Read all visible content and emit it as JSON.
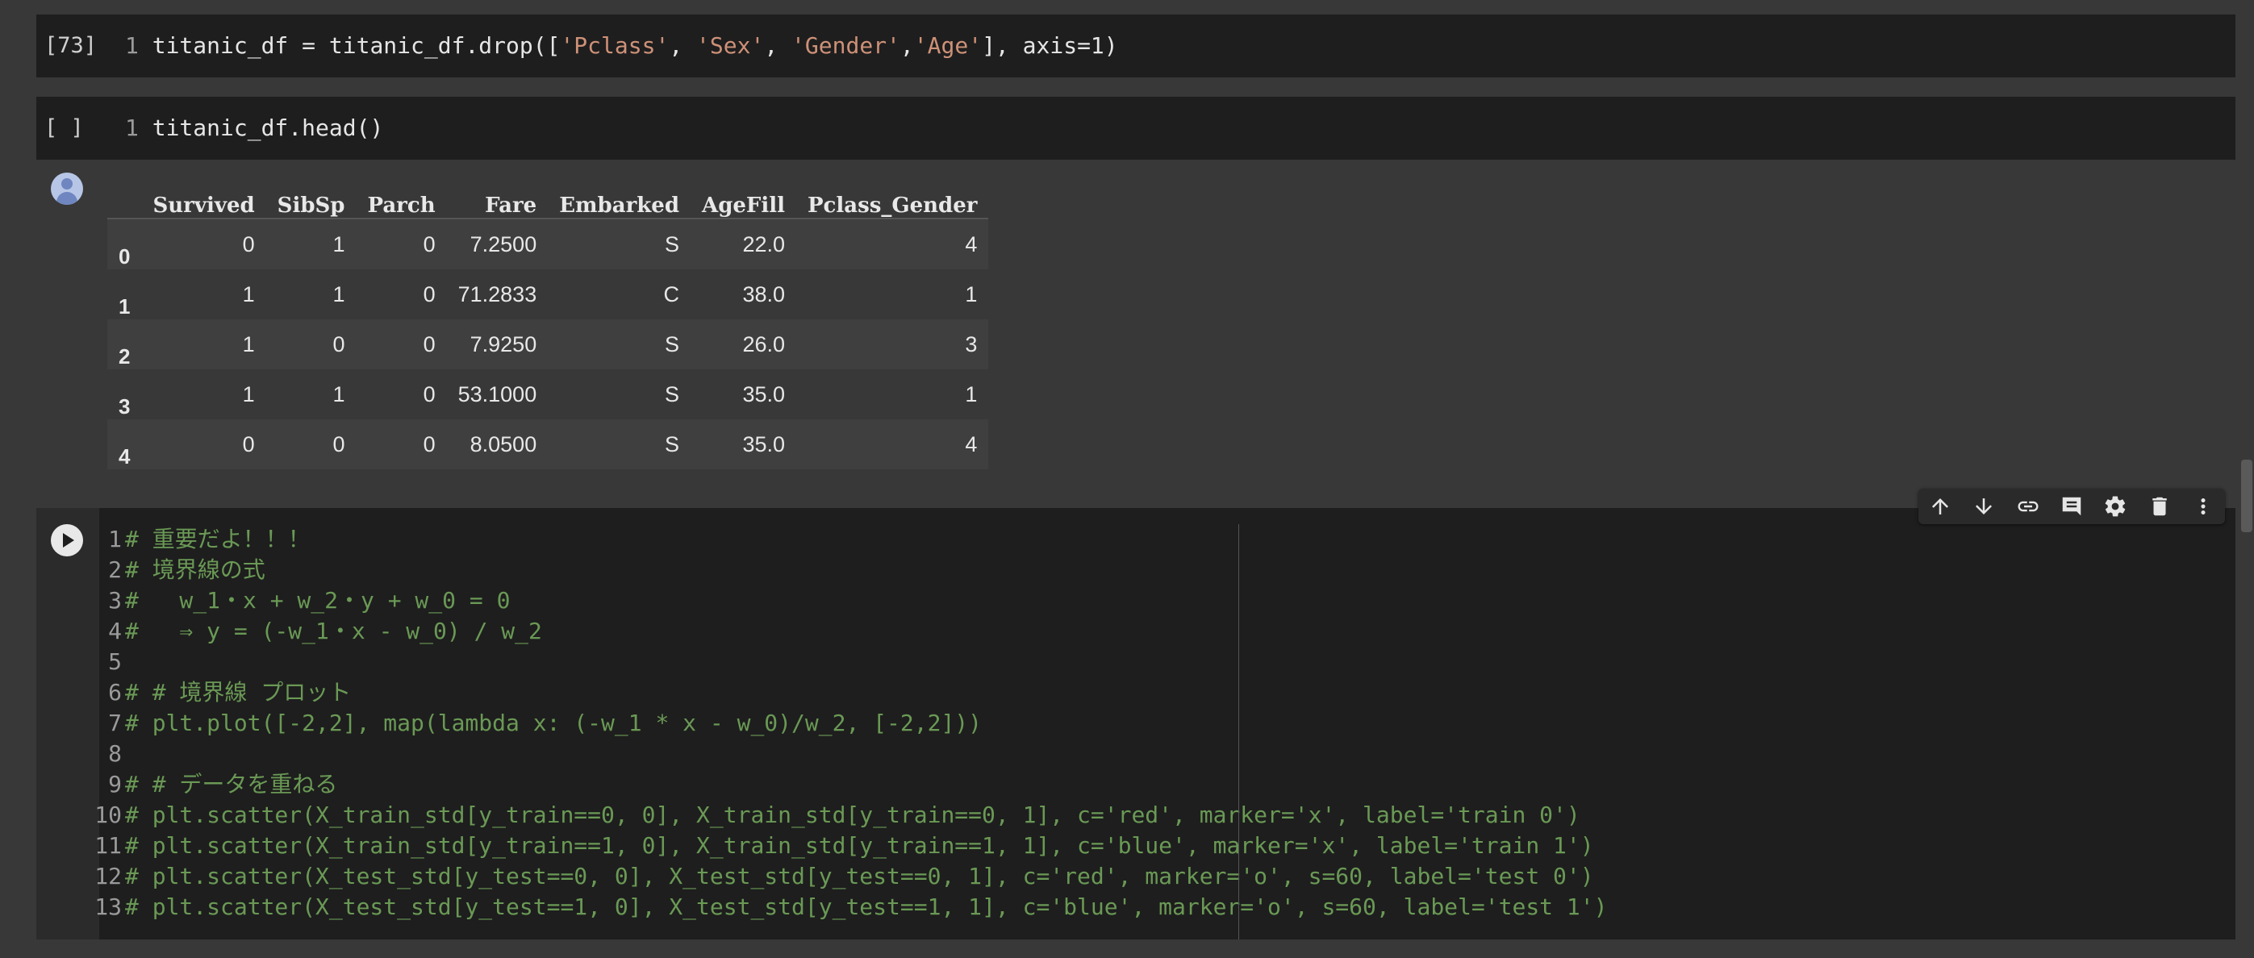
{
  "cells": {
    "drop": {
      "exec_count": "[73]",
      "line_no": "1",
      "code_prefix": "titanic_df = titanic_df.drop([",
      "s1": "'Pclass'",
      "sep1": ", ",
      "s2": "'Sex'",
      "sep2": ", ",
      "s3": "'Gender'",
      "sep3": ",",
      "s4": "'Age'",
      "code_suffix": "], axis=1)"
    },
    "head": {
      "exec_count": "[ ]",
      "line_no": "1",
      "code": "titanic_df.head()"
    },
    "comment_cell": {
      "lines": [
        {
          "n": "1",
          "text": "# 重要だよ！！！"
        },
        {
          "n": "2",
          "text": "# 境界線の式"
        },
        {
          "n": "3",
          "text": "#   w_1・x + w_2・y + w_0 = 0"
        },
        {
          "n": "4",
          "text": "#   ⇒ y = (-w_1・x - w_0) / w_2"
        },
        {
          "n": "5",
          "text": ""
        },
        {
          "n": "6",
          "text": "# # 境界線 プロット"
        },
        {
          "n": "7",
          "text": "# plt.plot([-2,2], map(lambda x: (-w_1 * x - w_0)/w_2, [-2,2]))"
        },
        {
          "n": "8",
          "text": ""
        },
        {
          "n": "9",
          "text": "# # データを重ねる"
        },
        {
          "n": "10",
          "text": "# plt.scatter(X_train_std[y_train==0, 0], X_train_std[y_train==0, 1], c='red', marker='x', label='train 0')"
        },
        {
          "n": "11",
          "text": "# plt.scatter(X_train_std[y_train==1, 0], X_train_std[y_train==1, 1], c='blue', marker='x', label='train 1')"
        },
        {
          "n": "12",
          "text": "# plt.scatter(X_test_std[y_test==0, 0], X_test_std[y_test==0, 1], c='red', marker='o', s=60, label='test 0')"
        },
        {
          "n": "13",
          "text": "# plt.scatter(X_test_std[y_test==1, 0], X_test_std[y_test==1, 1], c='blue', marker='o', s=60, label='test 1')"
        }
      ]
    }
  },
  "dataframe": {
    "columns": [
      "",
      "Survived",
      "SibSp",
      "Parch",
      "Fare",
      "Embarked",
      "AgeFill",
      "Pclass_Gender"
    ],
    "rows": [
      [
        "0",
        "0",
        "1",
        "0",
        "7.2500",
        "S",
        "22.0",
        "4"
      ],
      [
        "1",
        "1",
        "1",
        "0",
        "71.2833",
        "C",
        "38.0",
        "1"
      ],
      [
        "2",
        "1",
        "0",
        "0",
        "7.9250",
        "S",
        "26.0",
        "3"
      ],
      [
        "3",
        "1",
        "1",
        "0",
        "53.1000",
        "S",
        "35.0",
        "1"
      ],
      [
        "4",
        "0",
        "0",
        "0",
        "8.0500",
        "S",
        "35.0",
        "4"
      ]
    ]
  },
  "toolbar": {
    "icons": [
      "arrow-up-icon",
      "arrow-down-icon",
      "link-icon",
      "comment-icon",
      "gear-icon",
      "trash-icon",
      "more-vert-icon"
    ]
  },
  "colors": {
    "background": "#383838",
    "cell_bg": "#1e1e1e",
    "string": "#ce9178",
    "comment": "#6a9955"
  }
}
